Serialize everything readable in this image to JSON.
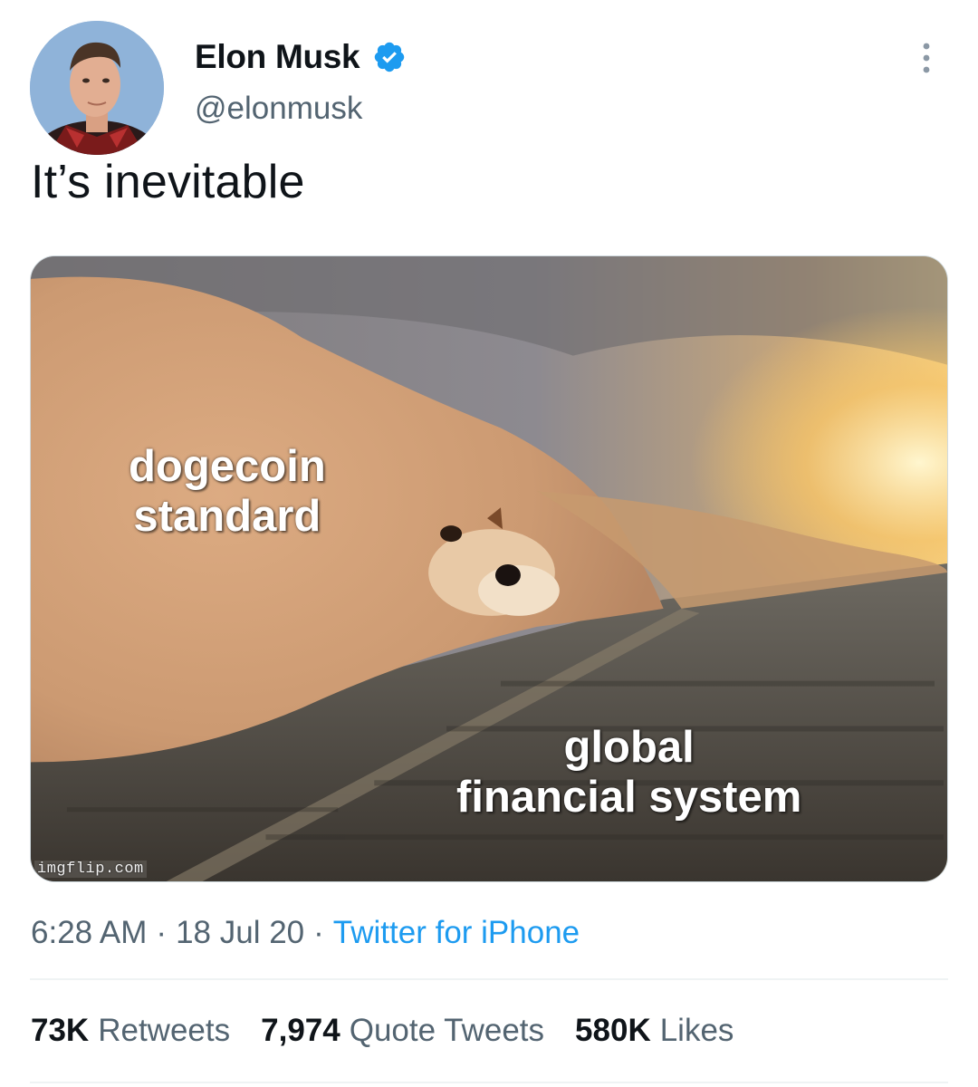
{
  "tweet": {
    "author": {
      "name": "Elon Musk",
      "handle": "@elonmusk",
      "verified": true
    },
    "text": "It’s inevitable",
    "media": {
      "caption_top": [
        "dogecoin",
        "standard"
      ],
      "caption_bottom": [
        "global",
        "financial system"
      ],
      "watermark": "imgflip.com"
    },
    "meta": {
      "time": "6:28 AM",
      "separator": "·",
      "date": "18 Jul 20",
      "source": "Twitter for iPhone"
    },
    "stats": [
      {
        "value": "73K",
        "label": "Retweets"
      },
      {
        "value": "7,974",
        "label": "Quote Tweets"
      },
      {
        "value": "580K",
        "label": "Likes"
      }
    ]
  },
  "icons": {
    "verified": "verified-badge-icon",
    "more": "more-options-icon"
  },
  "colors": {
    "accent": "#1d9bf0",
    "secondary_text": "#536471",
    "primary_text": "#0f1419",
    "divider": "#eff3f4"
  }
}
